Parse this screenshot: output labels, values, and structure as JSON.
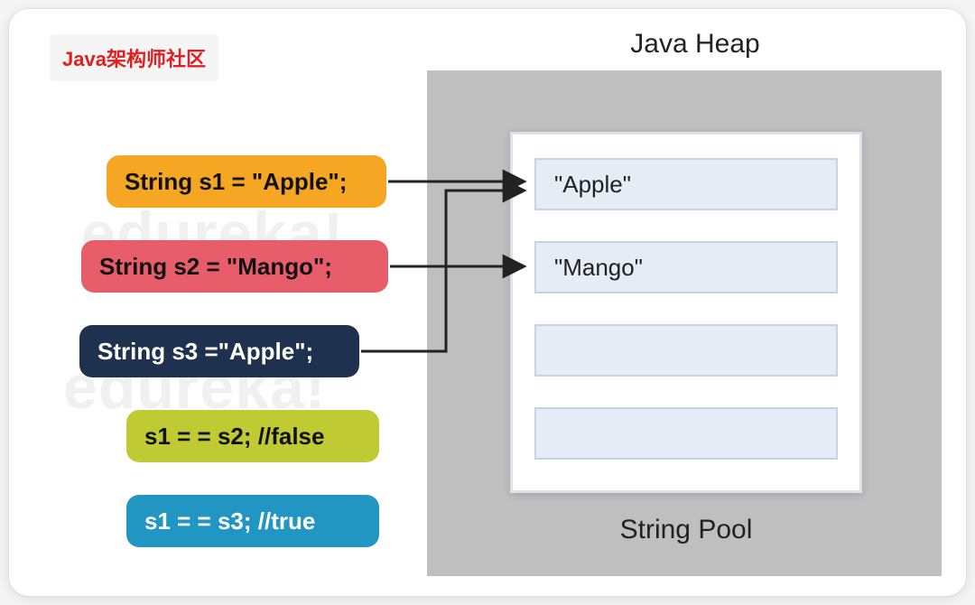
{
  "badge": "Java架构师社区",
  "heap_title": "Java Heap",
  "pool_title": "String Pool",
  "watermark": "edureka!",
  "pool_entries": [
    "\"Apple\"",
    "\"Mango\"",
    "",
    ""
  ],
  "statements": {
    "s1": "String s1 = \"Apple\";",
    "s2": "String s2 = \"Mango\";",
    "s3": "String s3 =\"Apple\";",
    "cmp1": "s1 = = s2; //false",
    "cmp2": "s1 = = s3; //true"
  },
  "colors": {
    "badge_text": "#e02020",
    "pill_orange": "#f5a623",
    "pill_red": "#e85d6a",
    "pill_navy": "#1e3250",
    "pill_lime": "#c0ca33",
    "pill_blue": "#2196c3",
    "heap_bg": "#bfbfbf",
    "pool_cell": "#e6ecf5"
  },
  "arrows": [
    {
      "from": "s1",
      "to": "Apple"
    },
    {
      "from": "s2",
      "to": "Mango"
    },
    {
      "from": "s3",
      "to": "Apple"
    }
  ]
}
